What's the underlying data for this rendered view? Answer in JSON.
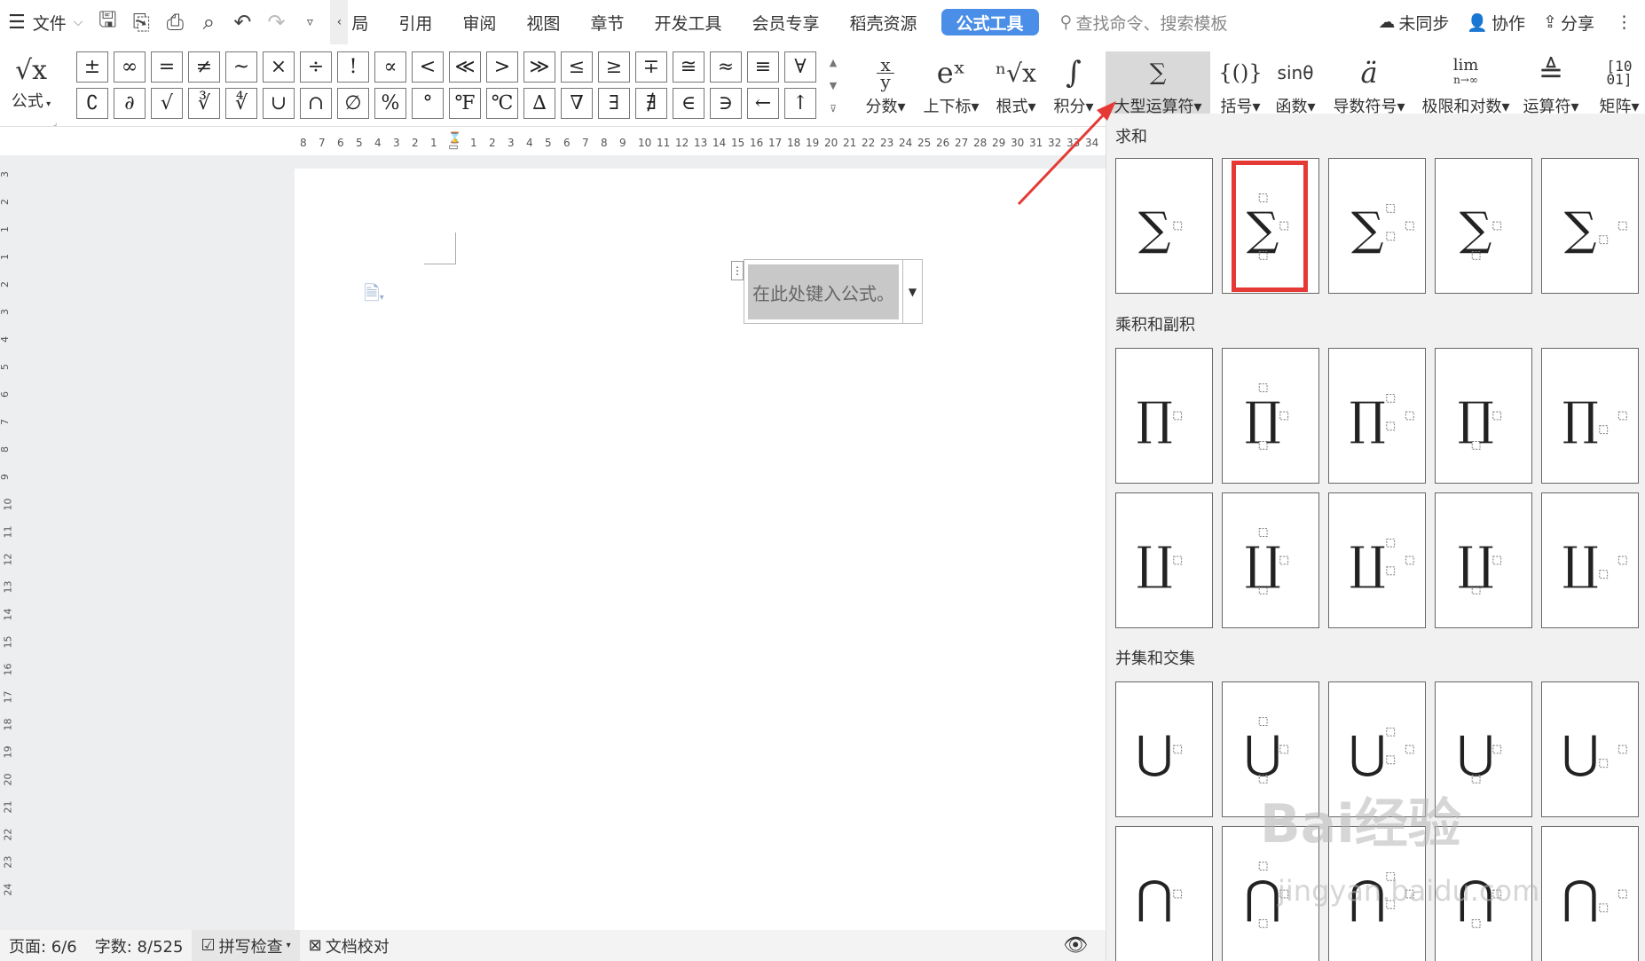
{
  "menubar": {
    "menu_label": "文件",
    "tabs": [
      "局",
      "引用",
      "审阅",
      "视图",
      "章节",
      "开发工具",
      "会员专享",
      "稻壳资源"
    ],
    "active_tab": "公式工具",
    "search_placeholder": "查找命令、搜索模板",
    "sync": "未同步",
    "collab": "协作",
    "share": "分享"
  },
  "ribbon": {
    "formula_label": "公式",
    "formula_icon": "√x",
    "symbols_row1": [
      "±",
      "∞",
      "=",
      "≠",
      "~",
      "×",
      "÷",
      "!",
      "∝",
      "<",
      "≪",
      ">",
      "≫",
      "≤",
      "≥",
      "∓",
      "≅",
      "≈",
      "≡",
      "∀"
    ],
    "symbols_row2": [
      "∁",
      "∂",
      "√",
      "∛",
      "∜",
      "∪",
      "∩",
      "∅",
      "%",
      "°",
      "℉",
      "℃",
      "∆",
      "∇",
      "∃",
      "∄",
      "∈",
      "∋",
      "←",
      "↑"
    ],
    "groups": [
      {
        "label": "分数",
        "icon": "x/y"
      },
      {
        "label": "上下标",
        "icon": "eˣ"
      },
      {
        "label": "根式",
        "icon": "ⁿ√x"
      },
      {
        "label": "积分",
        "icon": "∫"
      },
      {
        "label": "大型运算符",
        "icon": "∑"
      },
      {
        "label": "括号",
        "icon": "{()}"
      },
      {
        "label": "函数",
        "icon": "sinθ"
      },
      {
        "label": "导数符号",
        "icon": "ä"
      },
      {
        "label": "极限和对数",
        "icon": "lim"
      },
      {
        "label": "运算符",
        "icon": "≜"
      },
      {
        "label": "矩阵",
        "icon": "[10/01]"
      }
    ],
    "fraction_icon_num": "x",
    "fraction_icon_den": "y",
    "lim_sub": "n→∞"
  },
  "ruler_numbers": [
    "8",
    "7",
    "6",
    "5",
    "4",
    "3",
    "2",
    "1",
    "1",
    "2",
    "3",
    "4",
    "5",
    "6",
    "7",
    "8",
    "9",
    "10",
    "11",
    "12",
    "13",
    "14",
    "15",
    "16",
    "17",
    "18",
    "19",
    "20",
    "21",
    "22",
    "23",
    "24",
    "25",
    "26",
    "27",
    "28",
    "29",
    "30",
    "31",
    "32",
    "33",
    "34"
  ],
  "vruler_numbers": [
    "3",
    "2",
    "1",
    "1",
    "2",
    "3",
    "4",
    "5",
    "6",
    "7",
    "8",
    "9",
    "10",
    "11",
    "12",
    "13",
    "14",
    "15",
    "16",
    "17",
    "18",
    "19",
    "20",
    "21",
    "22",
    "23",
    "24"
  ],
  "document": {
    "equation_placeholder": "在此处键入公式。"
  },
  "panel": {
    "sections": [
      "求和",
      "乘积和副积",
      "并集和交集"
    ],
    "sum_symbol": "∑",
    "prod_symbol": "∏",
    "coprod_symbol": "∐",
    "union_symbol": "⋃",
    "inter_symbol": "⋂"
  },
  "statusbar": {
    "page": "页面: 6/6",
    "words": "字数: 8/525",
    "spell": "拼写检查",
    "proof": "文档校对"
  },
  "watermark": {
    "main": "Bai经验",
    "sub": "jingyan.baidu.com"
  },
  "colors": {
    "accent": "#4a8ee8",
    "highlight": "#e53935"
  }
}
